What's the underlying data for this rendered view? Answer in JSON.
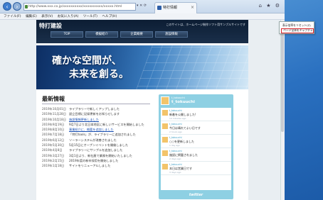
{
  "browser": {
    "address": "http://www.xxx.co.jp/xxxxxxxxxx/xxxxxxxxxx/xxxxx.html",
    "address_controls": "▾ ✕ ⟳",
    "tab_title": "特打情報",
    "window_icons": "⌂ ★ ⚙"
  },
  "menu": [
    "ファイル(F)",
    "編集(E)",
    "表示(V)",
    "お気に入り(A)",
    "ツール(T)",
    "ヘルプ(H)"
  ],
  "site": {
    "logo": "特打建設",
    "tagline": "このサイトは、ホームページ制作ソフト用サンプルサイトです",
    "nav": [
      "TOP",
      "模擬紹介",
      "企業概要",
      "施設情報"
    ],
    "hero_line1": "確かな空間が、",
    "hero_line2": "未来を創る。"
  },
  "news": {
    "title": "最新情報",
    "items": [
      {
        "date": "2019年10月01日",
        "text": "ライブラリーで新しくアップしました",
        "link": false
      },
      {
        "date": "2019年11月28日",
        "text": "設立目標に記録更新をお知らせします",
        "link": false
      },
      {
        "date": "2019年10月18日",
        "text": "施設情報更新しました",
        "link": true
      },
      {
        "date": "2019年9月19日",
        "text": "9月7日より北日本地区に新しいサービスを開始しました",
        "link": false
      },
      {
        "date": "2019年8月10日",
        "text": "事業紹介に、概要を追加しました",
        "link": true
      },
      {
        "date": "2019年7月18日",
        "text": "「特打tools」が、ライブラリーに追加されました",
        "link": false
      },
      {
        "date": "2019年6月12日",
        "text": "ソーラーシステムが改善されました",
        "link": false
      },
      {
        "date": "2019年5月30日",
        "text": "5月15日にオープンイベントを開催しました",
        "link": false
      },
      {
        "date": "2019年4月8日",
        "text": "ライブラリーにサンプルを追加しました",
        "link": false
      },
      {
        "date": "2019年3月27日",
        "text": "3月1日より、新社屋で業務を開始いたしました",
        "link": false
      },
      {
        "date": "2019年2月15日",
        "text": "2019年度の新卒採用を開始しました",
        "link": false
      },
      {
        "date": "2019年1月18日",
        "text": "サイトをリニューアルしました",
        "link": false
      }
    ]
  },
  "twitter": {
    "handle_small": "t_tokuuchi",
    "handle": "t_tokuuchi",
    "tweets": [
      {
        "user": "t_tokuuchi",
        "text": "新着を公開しました!",
        "meta": "14 minutes ago"
      },
      {
        "user": "t_tokuuchi",
        "text": "今日は晴れてよい日です",
        "meta": "2 hours ago"
      },
      {
        "user": "t_tokuuchi",
        "text": "○○を更新しました",
        "meta": "1 day ago"
      },
      {
        "user": "t_tokuuchi",
        "text": "施設に掲載されました",
        "meta": "2 days ago"
      },
      {
        "user": "t_tokuuchi",
        "text": "本日は営業日です",
        "meta": "3 days ago"
      }
    ],
    "footer": "twitter"
  },
  "context_menu": {
    "item1": "表示倍率をリセット(Z)",
    "item2": "ページ全体をキャプチャ"
  }
}
